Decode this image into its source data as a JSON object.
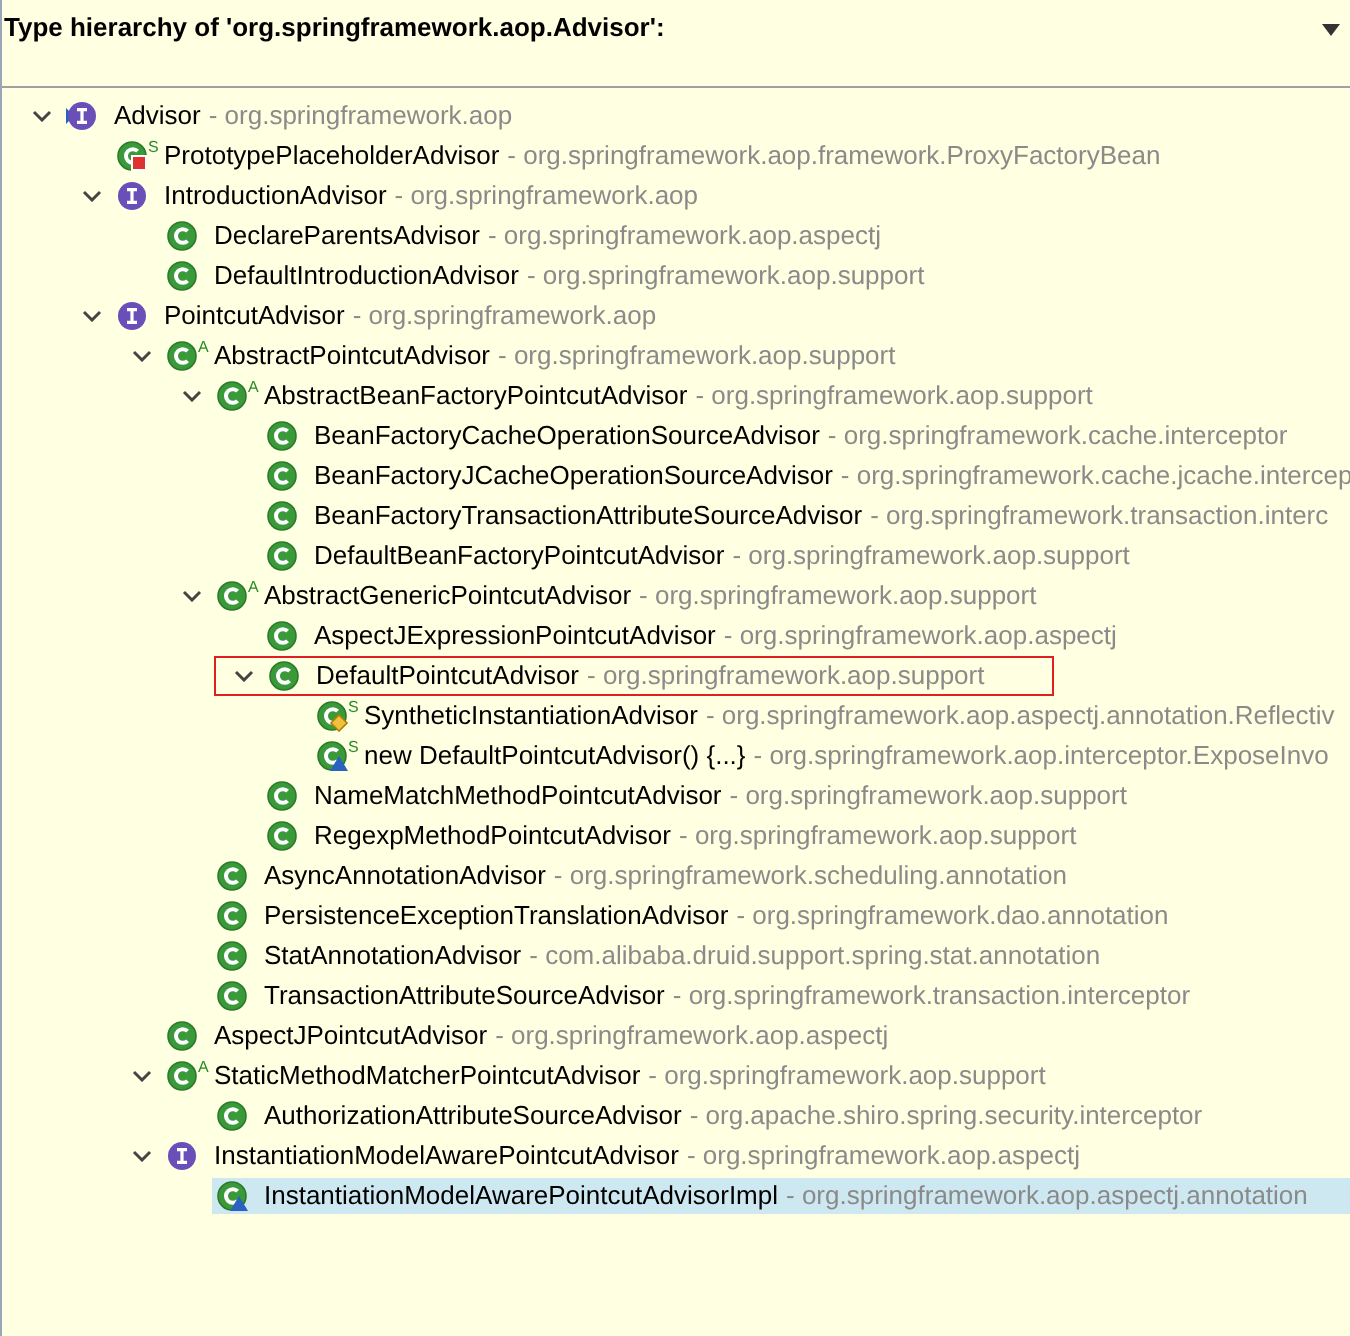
{
  "header": {
    "title": "Type hierarchy of 'org.springframework.aop.Advisor':"
  },
  "tree": [
    {
      "name": "Advisor",
      "package": "- org.springframework.aop",
      "icon": {
        "kind": "interface",
        "current": true
      },
      "expanded": true,
      "selected": false,
      "children": [
        {
          "name": "PrototypePlaceholderAdvisor",
          "package": "- org.springframework.aop.framework.ProxyFactoryBean",
          "icon": {
            "kind": "class",
            "private": true,
            "badge": "S"
          },
          "selected": false
        },
        {
          "name": "IntroductionAdvisor",
          "package": "- org.springframework.aop",
          "icon": {
            "kind": "interface"
          },
          "expanded": true,
          "selected": false,
          "children": [
            {
              "name": "DeclareParentsAdvisor",
              "package": "- org.springframework.aop.aspectj",
              "icon": {
                "kind": "class"
              },
              "selected": false
            },
            {
              "name": "DefaultIntroductionAdvisor",
              "package": "- org.springframework.aop.support",
              "icon": {
                "kind": "class"
              },
              "selected": false
            }
          ]
        },
        {
          "name": "PointcutAdvisor",
          "package": "- org.springframework.aop",
          "icon": {
            "kind": "interface"
          },
          "expanded": true,
          "selected": false,
          "children": [
            {
              "name": "AbstractPointcutAdvisor",
              "package": "- org.springframework.aop.support",
              "icon": {
                "kind": "class",
                "badge": "A"
              },
              "expanded": true,
              "selected": false,
              "children": [
                {
                  "name": "AbstractBeanFactoryPointcutAdvisor",
                  "package": "- org.springframework.aop.support",
                  "icon": {
                    "kind": "class",
                    "badge": "A"
                  },
                  "expanded": true,
                  "selected": false,
                  "children": [
                    {
                      "name": "BeanFactoryCacheOperationSourceAdvisor",
                      "package": "- org.springframework.cache.interceptor",
                      "icon": {
                        "kind": "class"
                      },
                      "selected": false
                    },
                    {
                      "name": "BeanFactoryJCacheOperationSourceAdvisor",
                      "package": "- org.springframework.cache.jcache.intercep",
                      "icon": {
                        "kind": "class"
                      },
                      "selected": false
                    },
                    {
                      "name": "BeanFactoryTransactionAttributeSourceAdvisor",
                      "package": "- org.springframework.transaction.interc",
                      "icon": {
                        "kind": "class"
                      },
                      "selected": false
                    },
                    {
                      "name": "DefaultBeanFactoryPointcutAdvisor",
                      "package": "- org.springframework.aop.support",
                      "icon": {
                        "kind": "class"
                      },
                      "selected": false
                    }
                  ]
                },
                {
                  "name": "AbstractGenericPointcutAdvisor",
                  "package": "- org.springframework.aop.support",
                  "icon": {
                    "kind": "class",
                    "badge": "A"
                  },
                  "expanded": true,
                  "selected": false,
                  "children": [
                    {
                      "name": "AspectJExpressionPointcutAdvisor",
                      "package": "- org.springframework.aop.aspectj",
                      "icon": {
                        "kind": "class"
                      },
                      "selected": false
                    },
                    {
                      "name": "DefaultPointcutAdvisor",
                      "package": "- org.springframework.aop.support",
                      "icon": {
                        "kind": "class"
                      },
                      "expanded": true,
                      "selected": false,
                      "outlined": true,
                      "children": [
                        {
                          "name": "SyntheticInstantiationAdvisor",
                          "package": "- org.springframework.aop.aspectj.annotation.Reflectiv",
                          "icon": {
                            "kind": "class",
                            "package_private": true,
                            "badge": "S"
                          },
                          "selected": false
                        },
                        {
                          "name": "new DefaultPointcutAdvisor() {...}",
                          "package": "- org.springframework.aop.interceptor.ExposeInvo",
                          "icon": {
                            "kind": "class",
                            "anonymous": true,
                            "badge": "S"
                          },
                          "selected": false
                        }
                      ]
                    },
                    {
                      "name": "NameMatchMethodPointcutAdvisor",
                      "package": "- org.springframework.aop.support",
                      "icon": {
                        "kind": "class"
                      },
                      "selected": false
                    },
                    {
                      "name": "RegexpMethodPointcutAdvisor",
                      "package": "- org.springframework.aop.support",
                      "icon": {
                        "kind": "class"
                      },
                      "selected": false
                    }
                  ]
                },
                {
                  "name": "AsyncAnnotationAdvisor",
                  "package": "- org.springframework.scheduling.annotation",
                  "icon": {
                    "kind": "class"
                  },
                  "selected": false
                },
                {
                  "name": "PersistenceExceptionTranslationAdvisor",
                  "package": "- org.springframework.dao.annotation",
                  "icon": {
                    "kind": "class"
                  },
                  "selected": false
                },
                {
                  "name": "StatAnnotationAdvisor",
                  "package": "- com.alibaba.druid.support.spring.stat.annotation",
                  "icon": {
                    "kind": "class"
                  },
                  "selected": false
                },
                {
                  "name": "TransactionAttributeSourceAdvisor",
                  "package": "- org.springframework.transaction.interceptor",
                  "icon": {
                    "kind": "class"
                  },
                  "selected": false
                }
              ]
            },
            {
              "name": "AspectJPointcutAdvisor",
              "package": "- org.springframework.aop.aspectj",
              "icon": {
                "kind": "class"
              },
              "selected": false
            },
            {
              "name": "StaticMethodMatcherPointcutAdvisor",
              "package": "- org.springframework.aop.support",
              "icon": {
                "kind": "class",
                "badge": "A"
              },
              "expanded": true,
              "selected": false,
              "children": [
                {
                  "name": "AuthorizationAttributeSourceAdvisor",
                  "package": "- org.apache.shiro.spring.security.interceptor",
                  "icon": {
                    "kind": "class"
                  },
                  "selected": false
                }
              ]
            },
            {
              "name": "InstantiationModelAwarePointcutAdvisor",
              "package": "- org.springframework.aop.aspectj",
              "icon": {
                "kind": "interface"
              },
              "expanded": true,
              "selected": false,
              "children": [
                {
                  "name": "InstantiationModelAwarePointcutAdvisorImpl",
                  "package": "- org.springframework.aop.aspectj.annotation",
                  "icon": {
                    "kind": "class",
                    "anonymous": true
                  },
                  "selected": true
                }
              ]
            }
          ]
        }
      ]
    }
  ]
}
